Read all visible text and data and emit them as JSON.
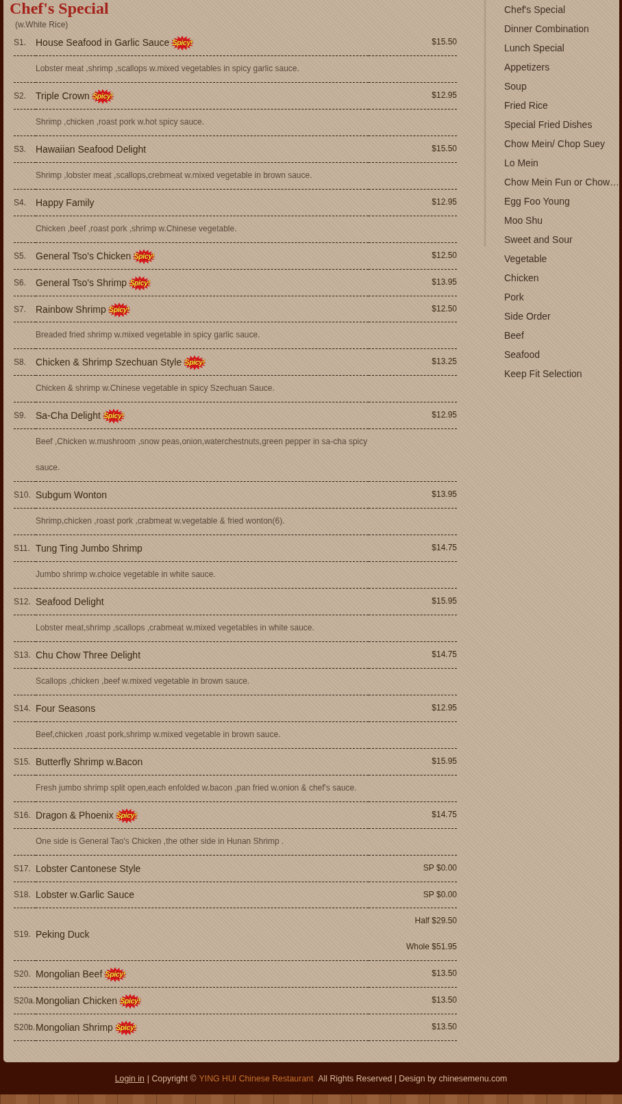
{
  "menu": {
    "heading": "Chef's Special",
    "subtitle": "(w.White Rice)",
    "items": [
      {
        "number": "S1.",
        "name": "House Seafood in Garlic Sauce",
        "badge": "Spicy!",
        "prices": [
          "$15.50"
        ],
        "description": "Lobster meat ,shrimp ,scallops w.mixed vegetables in spicy garlic sauce."
      },
      {
        "number": "S2.",
        "name": "Triple Crown",
        "badge": "Spicy!",
        "prices": [
          "$12.95"
        ],
        "description": "Shrimp ,chicken ,roast pork w.hot spicy sauce."
      },
      {
        "number": "S3.",
        "name": "Hawaiian Seafood Delight",
        "prices": [
          "$15.50"
        ],
        "description": "Shrimp ,lobster meat ,scallops,crebmeat w.mixed vegetable in brown sauce."
      },
      {
        "number": "S4.",
        "name": "Happy Family",
        "prices": [
          "$12.95"
        ],
        "description": "Chicken ,beef ,roast pork ,shrimp w.Chinese vegetable."
      },
      {
        "number": "S5.",
        "name": "General Tso's Chicken",
        "badge": "Spicy!",
        "prices": [
          "$12.50"
        ]
      },
      {
        "number": "S6.",
        "name": "General Tso's Shrimp",
        "badge": "Spicy!",
        "prices": [
          "$13.95"
        ]
      },
      {
        "number": "S7.",
        "name": "Rainbow Shrimp",
        "badge": "Spicy!",
        "prices": [
          "$12.50"
        ],
        "description": "Breaded fried shrimp w.mixed vegetable in spicy garlic sauce."
      },
      {
        "number": "S8.",
        "name": "Chicken & Shrimp Szechuan Style",
        "badge": "Spicy!",
        "prices": [
          "$13.25"
        ],
        "description": "Chicken & shrimp w.Chinese vegetable in spicy Szechuan Sauce."
      },
      {
        "number": "S9.",
        "name": "Sa-Cha Delight",
        "badge": "Spicy!",
        "prices": [
          "$12.95"
        ],
        "description": "Beef ,Chicken w.mushroom ,snow peas,onion,waterchestnuts,green pepper in sa-cha spicy sauce."
      },
      {
        "number": "S10.",
        "name": "Subgum Wonton",
        "prices": [
          "$13.95"
        ],
        "description": "Shrimp,chicken ,roast pork ,crabmeat w.vegetable & fried wonton(6)."
      },
      {
        "number": "S11.",
        "name": "Tung Ting Jumbo Shrimp",
        "prices": [
          "$14.75"
        ],
        "description": "Jumbo shrimp w.choice vegetable in white sauce."
      },
      {
        "number": "S12.",
        "name": "Seafood Delight",
        "prices": [
          "$15.95"
        ],
        "description": "Lobster meat,shrimp ,scallops ,crabmeat w.mixed vegetables in white sauce."
      },
      {
        "number": "S13.",
        "name": "Chu Chow Three Delight",
        "prices": [
          "$14.75"
        ],
        "description": "Scallops ,chicken ,beef w.mixed vegetable in brown sauce."
      },
      {
        "number": "S14.",
        "name": "Four Seasons",
        "prices": [
          "$12.95"
        ],
        "description": "Beef,chicken ,roast pork,shrimp w.mixed vegetable in brown sauce."
      },
      {
        "number": "S15.",
        "name": "Butterfly Shrimp w.Bacon",
        "prices": [
          "$15.95"
        ],
        "description": "Fresh jumbo shrimp split open,each enfolded w.bacon ,pan fried w.onion & chef's sauce."
      },
      {
        "number": "S16.",
        "name": "Dragon & Phoenix",
        "badge": "Spicy!",
        "prices": [
          "$14.75"
        ],
        "description": "One side is General Tao's Chicken ,the other side in Hunan Shrimp ."
      },
      {
        "number": "S17.",
        "name": "Lobster Cantonese Style",
        "prices": [
          "SP $0.00"
        ]
      },
      {
        "number": "S18.",
        "name": "Lobster w.Garlic Sauce",
        "prices": [
          "SP $0.00"
        ]
      },
      {
        "number": "S19.",
        "name": "Peking Duck",
        "prices": [
          "Half $29.50",
          "Whole $51.95"
        ]
      },
      {
        "number": "S20.",
        "name": "Mongolian Beef",
        "badge": "Spicy!",
        "prices": [
          "$13.50"
        ]
      },
      {
        "number": "S20a.",
        "name": "Mongolian Chicken",
        "badge": "Spicy!",
        "prices": [
          "$13.50"
        ]
      },
      {
        "number": "S20b.",
        "name": "Mongolian Shrimp",
        "badge": "Spicy!",
        "prices": [
          "$13.50"
        ]
      }
    ]
  },
  "sidebar": {
    "items": [
      "Chef's Special",
      "Dinner Combination",
      "Lunch Special",
      "Appetizers",
      "Soup",
      "Fried Rice",
      "Special Fried Dishes",
      "Chow Mein/ Chop Suey",
      "Lo Mein",
      "Chow Mein Fun or Chow…",
      "Egg Foo Young",
      "Moo Shu",
      "Sweet and Sour",
      "Vegetable",
      "Chicken",
      "Pork",
      "Side Order",
      "Beef",
      "Seafood",
      "Keep Fit Selection"
    ]
  },
  "footer": {
    "login_link": "Login in",
    "copyright": "| Copyright ©",
    "restaurant_link": "YING HUI Chinese Restaurant",
    "rights": "All Rights Reserved | Design by chinesemenu.com"
  }
}
